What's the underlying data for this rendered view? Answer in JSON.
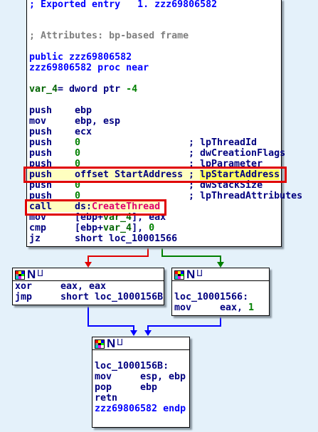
{
  "main_block": {
    "lines": [
      {
        "t": "; Exported entry   1. zzz69806582"
      },
      {
        "t": "; Attributes: bp-based frame"
      },
      {
        "t": "public zzz69806582"
      },
      {
        "t": "zzz69806582 proc near"
      },
      {
        "a": "var_4",
        "b": "= dword ptr ",
        "c": "-4"
      },
      {
        "m": "push",
        "o": "ebp"
      },
      {
        "m": "mov",
        "o": "ebp, esp"
      },
      {
        "m": "push",
        "o": "ecx"
      },
      {
        "m": "push",
        "o": "0",
        "c": "; lpThreadId"
      },
      {
        "m": "push",
        "o": "0",
        "c": "; dwCreationFlags"
      },
      {
        "m": "push",
        "o": "0",
        "c": "; lpParameter"
      },
      {
        "m": "push",
        "o": "offset StartAddress",
        "c": "; ",
        "h": "lpStartAddress"
      },
      {
        "m": "push",
        "o": "0",
        "c": "; dwStackSize"
      },
      {
        "m": "push",
        "o": "0",
        "c": "; lpThreadAttributes"
      },
      {
        "m": "call",
        "o": "ds:",
        "api": "CreateThread"
      },
      {
        "m": "mov",
        "o1": "[ebp+",
        "v": "var_4",
        "o2": "], eax"
      },
      {
        "m": "cmp",
        "o1": "[ebp+",
        "v": "var_4",
        "o2": "], ",
        "n": "0"
      },
      {
        "m": "jz",
        "o": "short loc_10001566"
      }
    ]
  },
  "node_header": {
    "n_label": "N",
    "graph_glyph": "ⵡ"
  },
  "left_block": {
    "l1m": "xor",
    "l1o": "eax, eax",
    "l2m": "jmp",
    "l2o": "short loc_1000156B"
  },
  "right_block": {
    "label": "loc_10001566:",
    "m": "mov",
    "o": "eax, ",
    "n": "1"
  },
  "bottom_block": {
    "label": "loc_1000156B:",
    "l1m": "mov",
    "l1o": "esp, ebp",
    "l2m": "pop",
    "l2o": "ebp",
    "l3m": "retn",
    "endp": "zzz69806582 endp"
  },
  "colors": {
    "false_edge": "#e00000",
    "true_edge": "#008000",
    "jump_edge": "#0000ff",
    "highlight": "#e00000"
  }
}
